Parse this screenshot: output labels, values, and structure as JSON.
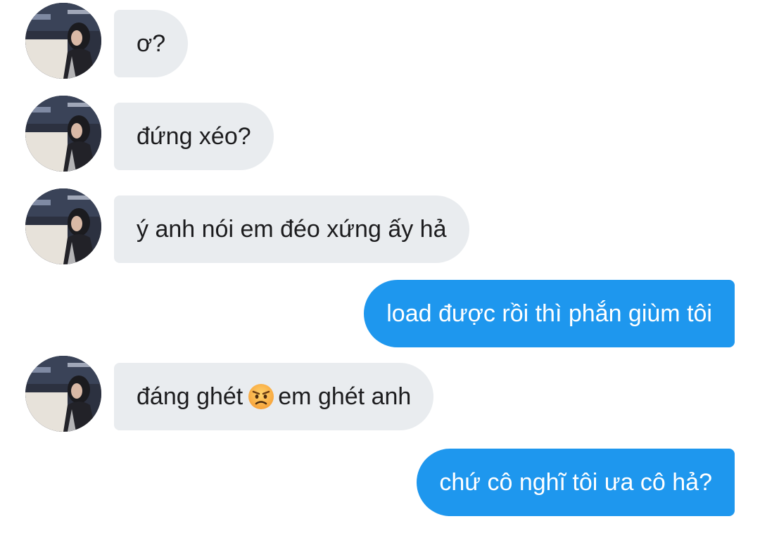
{
  "conversation": {
    "messages": [
      {
        "direction": "incoming",
        "text": "ơ?"
      },
      {
        "direction": "incoming",
        "text": "đứng xéo?"
      },
      {
        "direction": "incoming",
        "text": "ý anh nói em đéo xứng ấy hả"
      },
      {
        "direction": "outgoing",
        "text": "load được rồi thì phắn giùm tôi"
      },
      {
        "direction": "incoming",
        "text_before": "đáng ghét",
        "emoji": "angry-face",
        "text_after": "em ghét anh"
      },
      {
        "direction": "outgoing",
        "text": "chứ cô nghĩ tôi ưa cô hả?"
      }
    ]
  },
  "colors": {
    "incoming_bubble": "#e9ecef",
    "outgoing_bubble": "#1e97ee",
    "outgoing_text": "#ffffff",
    "incoming_text": "#1c1c1e"
  }
}
